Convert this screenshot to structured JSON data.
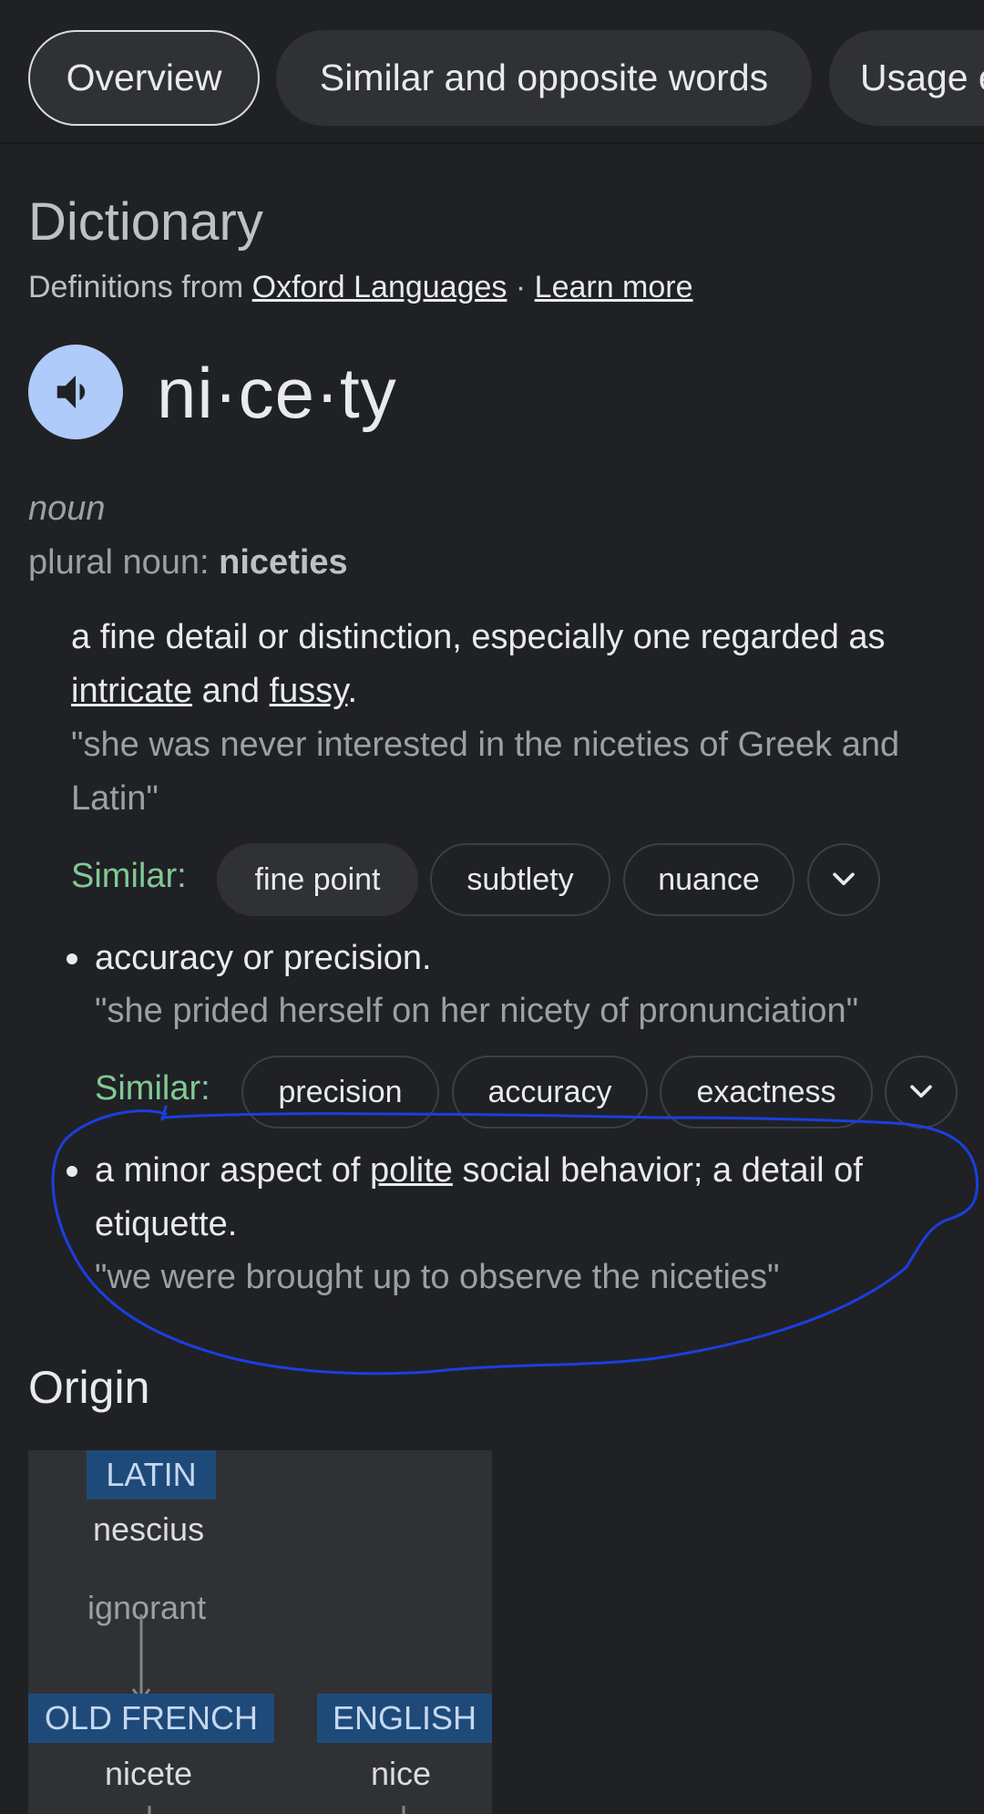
{
  "tabs": [
    {
      "label": "Overview"
    },
    {
      "label": "Similar and opposite words"
    },
    {
      "label": "Usage examples"
    }
  ],
  "dictionary": {
    "title": "Dictionary",
    "source_prefix": "Definitions from",
    "source_link": "Oxford Languages",
    "separator": "·",
    "learn_more": "Learn more"
  },
  "entry": {
    "word": "ni·ce·ty",
    "part_of_speech": "noun",
    "plural_label": "plural noun:",
    "plural_form": "niceties"
  },
  "definitions": [
    {
      "text_a": "a fine detail or distinction, especially one regarded as",
      "link_1": "intricate",
      "text_b": "and",
      "link_2": "fussy",
      "text_c": ".",
      "example_line1": "\"she was never interested in the niceties of Greek and",
      "example_line2": "Latin\"",
      "similar_label": "Similar:",
      "similar": [
        "fine point",
        "subtlety",
        "nuance"
      ]
    },
    {
      "text": "accuracy or precision.",
      "example": "\"she prided herself on her nicety of pronunciation\"",
      "similar_label": "Similar:",
      "similar": [
        "precision",
        "accuracy",
        "exactness"
      ]
    },
    {
      "text_a": "a minor aspect of",
      "link_1": "polite",
      "text_b": "social behavior; a detail of",
      "text_line2": "etiquette.",
      "example": "\"we were brought up to observe the niceties\""
    }
  ],
  "origin": {
    "title": "Origin",
    "nodes": [
      {
        "lang": "LATIN",
        "word": "nescius",
        "gloss": "ignorant"
      },
      {
        "lang": "OLD FRENCH",
        "word": "nicete"
      },
      {
        "lang": "ENGLISH",
        "word": "nice"
      }
    ]
  },
  "colors": {
    "background": "#202124",
    "similar_label": "#81c995",
    "speaker": "#aecbfa",
    "annotation_stroke": "#1a3fe0",
    "lang_tag": "#1e4a7a"
  }
}
